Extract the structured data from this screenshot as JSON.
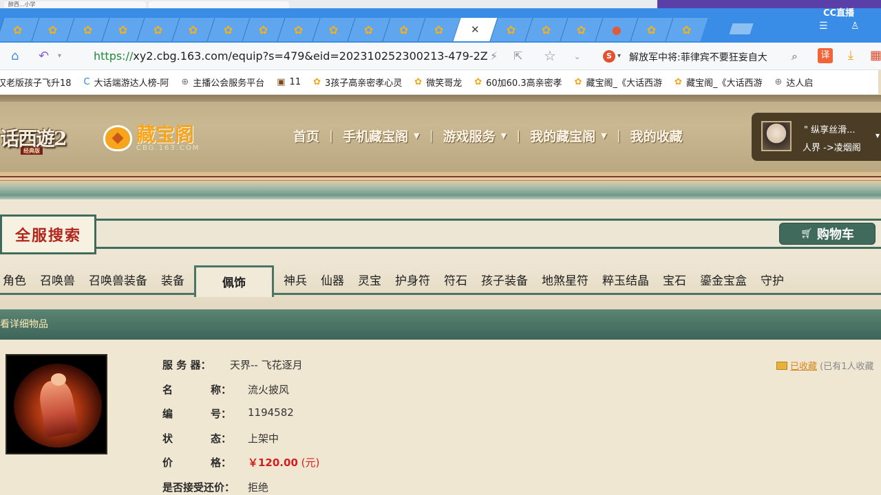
{
  "browser": {
    "first_tab_title": "醉西...小学",
    "tabs_count": 20,
    "cc_logo": "CC直播",
    "url_scheme": "https://",
    "url_rest": "xy2.cbg.163.com/equip?s=479&eid=202310252300213-479-2Z",
    "hot_search": "解放军中将:菲律宾不要狂妄自大",
    "translate_label": "译"
  },
  "bookmarks": [
    {
      "label": "汉老版孩子飞升18",
      "icon": "chick-icon"
    },
    {
      "label": "大话端游达人榜-阿",
      "icon": "c-icon"
    },
    {
      "label": "主播公会服务平台",
      "icon": "globe-icon"
    },
    {
      "label": "11",
      "icon": "game-icon"
    },
    {
      "label": "3孩子高亲密孝心灵",
      "icon": "chick-icon"
    },
    {
      "label": "微笑哥龙",
      "icon": "chick-icon"
    },
    {
      "label": "60加60.3高亲密孝",
      "icon": "chick-icon"
    },
    {
      "label": "藏宝阁_《大话西游",
      "icon": "chick-icon"
    },
    {
      "label": "藏宝阁_《大话西游",
      "icon": "chick-icon"
    },
    {
      "label": "达人启",
      "icon": "globe-icon"
    }
  ],
  "site": {
    "game_logo": "话西遊2",
    "game_logo_sub": "经典版",
    "cbg_name": "藏宝阁",
    "cbg_domain": "CBG.163.COM",
    "nav": [
      {
        "label": "首页",
        "dropdown": false
      },
      {
        "label": "手机藏宝阁",
        "dropdown": true
      },
      {
        "label": "游戏服务",
        "dropdown": true
      },
      {
        "label": "我的藏宝阁",
        "dropdown": true
      },
      {
        "label": "我的收藏",
        "dropdown": false
      }
    ],
    "user": {
      "name": "\" 纵享丝滑...",
      "area": "人界 ->凌烟阁"
    }
  },
  "search": {
    "label": "全服搜索",
    "cart_label": "购物车"
  },
  "categories": [
    "角色",
    "召唤兽",
    "召唤兽装备",
    "装备",
    "佩饰",
    "神兵",
    "仙器",
    "灵宝",
    "护身符",
    "符石",
    "孩子装备",
    "地煞星符",
    "粹玉结晶",
    "宝石",
    "鎏金宝盒",
    "守护"
  ],
  "active_category": "佩饰",
  "detail": {
    "header": "看详细物品",
    "server_label": "服 务 器：",
    "server_value": "天界-- 飞花逐月",
    "name_label_a": "名",
    "name_label_b": "称：",
    "name_value": "流火披风",
    "id_label_a": "编",
    "id_label_b": "号：",
    "id_value": "1194582",
    "status_label_a": "状",
    "status_label_b": "态：",
    "status_value": "上架中",
    "price_label_a": "价",
    "price_label_b": "格：",
    "price_value": "￥120.00",
    "price_unit": " (元)",
    "bargain_label": "是否接受还价：",
    "bargain_value": "拒绝",
    "fav_label": "已收藏",
    "fav_count": "(已有1人收藏"
  },
  "colors": {
    "accent_green": "#3f6a5c",
    "price_red": "#d21e1e",
    "browser_blue": "#3a8de6"
  }
}
